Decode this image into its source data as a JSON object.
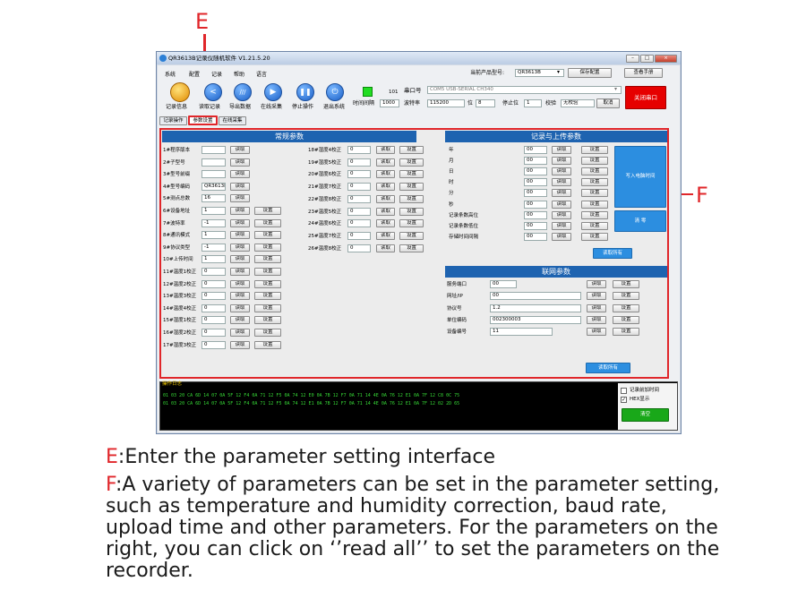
{
  "annotations": {
    "e_marker": "E",
    "f_marker": "F"
  },
  "window": {
    "title": "QR3613B记录仪随机软件  V1.21.5.20"
  },
  "menu": [
    "系统",
    "配置",
    "记录",
    "帮助",
    "语言"
  ],
  "header": {
    "product_label": "当前产品型号:",
    "product_value": "QR3613B",
    "save_config": "保存配置",
    "view_manual": "查看手册"
  },
  "toolbar": {
    "buttons": [
      "记录信息",
      "读取记录",
      "导出数据",
      "在线采集",
      "停止操作",
      "退出系统"
    ],
    "interval_label": "时间间隔",
    "interval_value": "1000",
    "counter": "101",
    "port_label": "串口号",
    "port_value": "COM5 USB-SERIAL CH340",
    "baud_label": "波特率",
    "baud_value": "115200",
    "bits_label": "位",
    "bits_value": "8",
    "stop_label": "停止位",
    "stop_value": "1",
    "parity_label": "校验",
    "parity_value": "无校验",
    "cancel": "取消",
    "close_port": "关闭串口"
  },
  "tabs": [
    "记录操作",
    "参数设置",
    "在线采集"
  ],
  "general": {
    "title": "常规参数",
    "read": "读取",
    "set": "设置",
    "left": [
      {
        "label": "1#程序版本",
        "value": "",
        "set": false
      },
      {
        "label": "2#子型号",
        "value": "",
        "set": false
      },
      {
        "label": "3#型号前缀",
        "value": "",
        "set": false
      },
      {
        "label": "4#型号编码",
        "value": "QR3613B",
        "set": false
      },
      {
        "label": "5#测点总数",
        "value": "16",
        "set": false
      },
      {
        "label": "6#设备地址",
        "value": "1",
        "set": true
      },
      {
        "label": "7#波特率",
        "value": "-1",
        "set": true
      },
      {
        "label": "8#通讯模式",
        "value": "1",
        "set": true
      },
      {
        "label": "9#协议类型",
        "value": "-1",
        "set": true
      },
      {
        "label": "10#上传时间",
        "value": "1",
        "set": true
      },
      {
        "label": "11#温度1校正",
        "value": "0",
        "set": true
      },
      {
        "label": "12#温度2校正",
        "value": "0",
        "set": true
      },
      {
        "label": "13#温度3校正",
        "value": "0",
        "set": true
      },
      {
        "label": "14#温度4校正",
        "value": "0",
        "set": true
      },
      {
        "label": "15#湿度1校正",
        "value": "0",
        "set": true
      },
      {
        "label": "16#湿度2校正",
        "value": "0",
        "set": true
      },
      {
        "label": "17#湿度3校正",
        "value": "0",
        "set": true
      }
    ],
    "right": [
      {
        "label": "18#湿度4校正",
        "value": "0"
      },
      {
        "label": "19#湿度5校正",
        "value": "0"
      },
      {
        "label": "20#湿度6校正",
        "value": "0"
      },
      {
        "label": "21#湿度7校正",
        "value": "0"
      },
      {
        "label": "22#湿度8校正",
        "value": "0"
      },
      {
        "label": "23#温度5校正",
        "value": "0"
      },
      {
        "label": "24#温度6校正",
        "value": "0"
      },
      {
        "label": "25#温度7校正",
        "value": "0"
      },
      {
        "label": "26#温度8校正",
        "value": "0"
      }
    ]
  },
  "record": {
    "title": "记录与上传参数",
    "rows": [
      {
        "label": "年",
        "value": "00"
      },
      {
        "label": "月",
        "value": "00"
      },
      {
        "label": "日",
        "value": "00"
      },
      {
        "label": "时",
        "value": "00"
      },
      {
        "label": "分",
        "value": "00"
      },
      {
        "label": "秒",
        "value": "00"
      },
      {
        "label": "记录条数高位",
        "value": "00"
      },
      {
        "label": "记录条数低位",
        "value": "00"
      },
      {
        "label": "存储时间间隔",
        "value": "00"
      }
    ],
    "write_time": "写入电脑时间",
    "clear": "清 零",
    "read_all": "读取所有"
  },
  "network": {
    "title": "联网参数",
    "rows": [
      {
        "label": "服务端口",
        "value": "00"
      },
      {
        "label": "网址/IP",
        "value": "00"
      },
      {
        "label": "协议号",
        "value": "1.2"
      },
      {
        "label": "单位编码",
        "value": "002300003"
      },
      {
        "label": "设备编号",
        "value": "11"
      }
    ],
    "read_all": "读取所有"
  },
  "log": {
    "title": "操作日志",
    "lines": [
      "01 03 20 CA 6D 14 07 0A 5F 12 F4 0A 71 12 F5 0A 74 12 E0 0A 7B 12 F7 0A 71 14 4E 0A 76 12 E1 0A 7F 12 C8 0C 75",
      "01 03 20 CA 6D 14 07 0A 5F 12 F4 0A 71 12 F5 0A 74 12 E1 0A 7B 12 F7 0A 71 14 4E 0A 76 12 E1 0A 7F 12 02 2D 65"
    ],
    "opt1": "记录前加时间",
    "opt2": "HEX显示",
    "clear": "清空"
  },
  "caption": {
    "e_key": "E",
    "e_text": ":Enter the parameter setting interface",
    "f_key": "F",
    "f_lines": [
      ":A variety of parameters can be set in the parameter setting,",
      "such as temperature and humidity correction, baud rate,",
      "upload time and other parameters. For the parameters on the",
      "right, you can click on ‘’read all’’ to set the parameters on the",
      "recorder."
    ]
  }
}
